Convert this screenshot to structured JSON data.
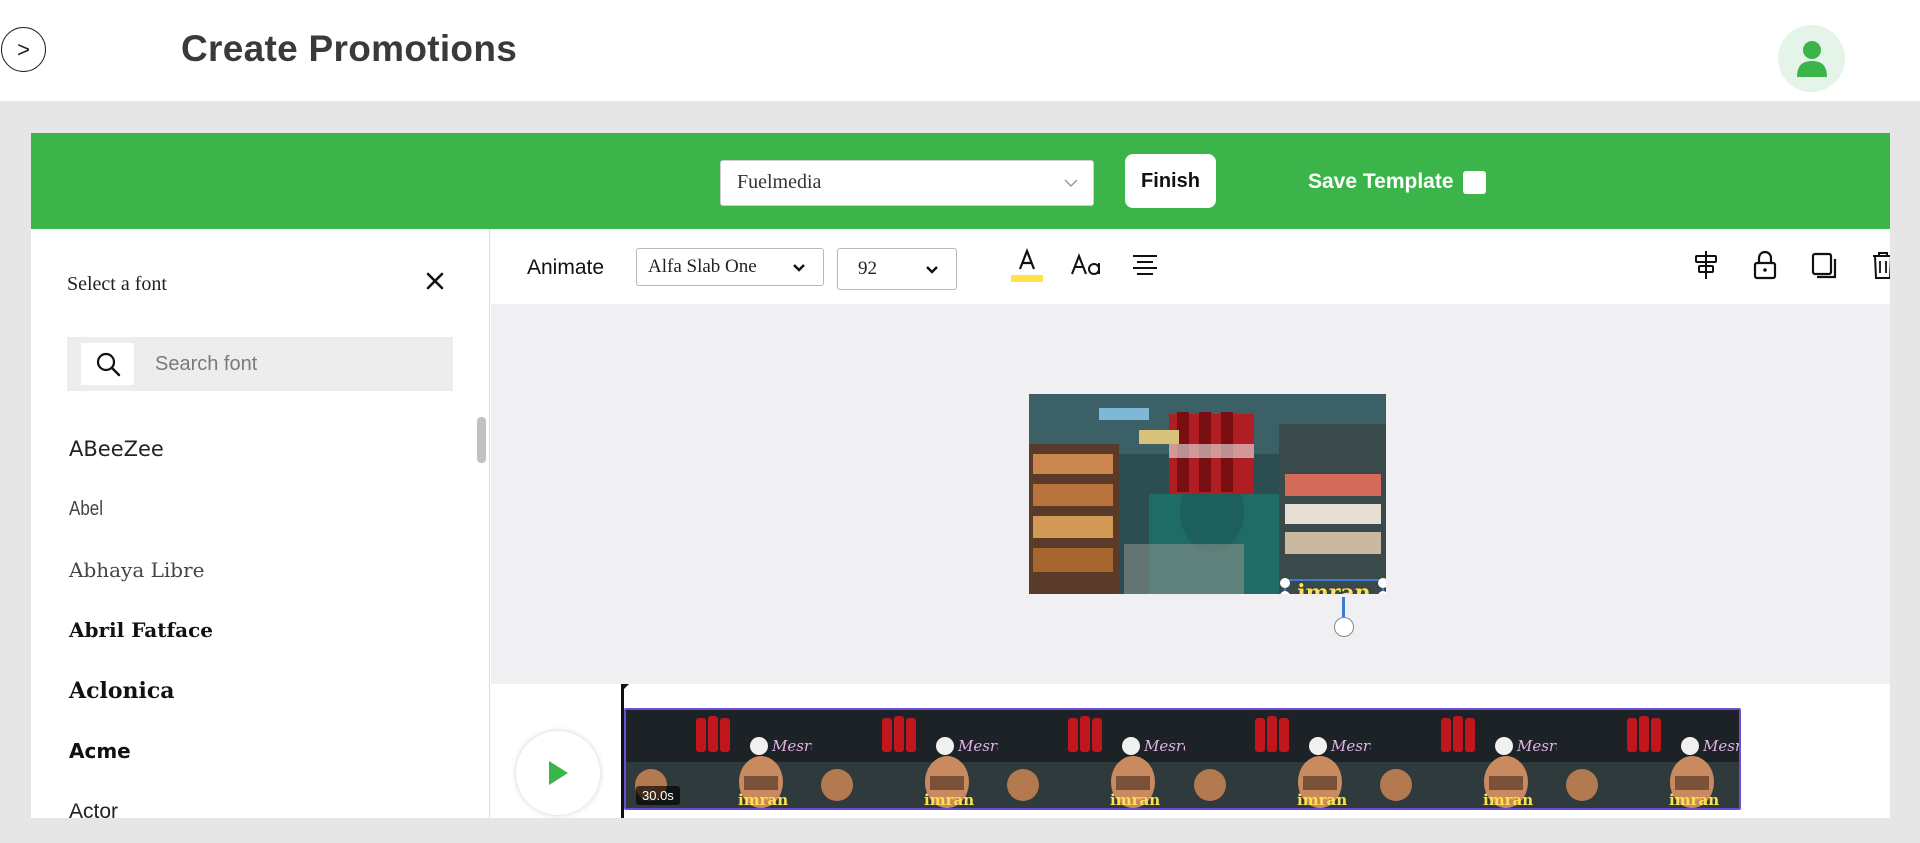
{
  "header": {
    "nav_toggle": ">",
    "title": "Create Promotions"
  },
  "editor": {
    "brand_select": "Fuelmedia",
    "finish_label": "Finish",
    "save_template_label": "Save Template",
    "save_template_checked": false
  },
  "sidebar": {
    "title": "Select a font",
    "search_placeholder": "Search font",
    "fonts": [
      "ABeeZee",
      "Abel",
      "Abhaya Libre",
      "Abril Fatface",
      "Aclonica",
      "Acme",
      "Actor"
    ]
  },
  "toolbar": {
    "animate_label": "Animate",
    "font_family": "Alfa Slab One",
    "font_size": "92",
    "text_color": "#ffe14a",
    "icons": [
      "text-color-icon",
      "text-case-icon",
      "align-center-icon",
      "align-layers-icon",
      "lock-icon",
      "duplicate-icon",
      "trash-icon"
    ]
  },
  "canvas": {
    "overlay_text": "imran"
  },
  "timeline": {
    "duration": "30.0s",
    "thumb_text": "imran",
    "thumb_count": 6
  },
  "colors": {
    "brand_green": "#3bb54a",
    "track_border": "#6a4fd0",
    "avatar_icon": "#3bb54a"
  }
}
